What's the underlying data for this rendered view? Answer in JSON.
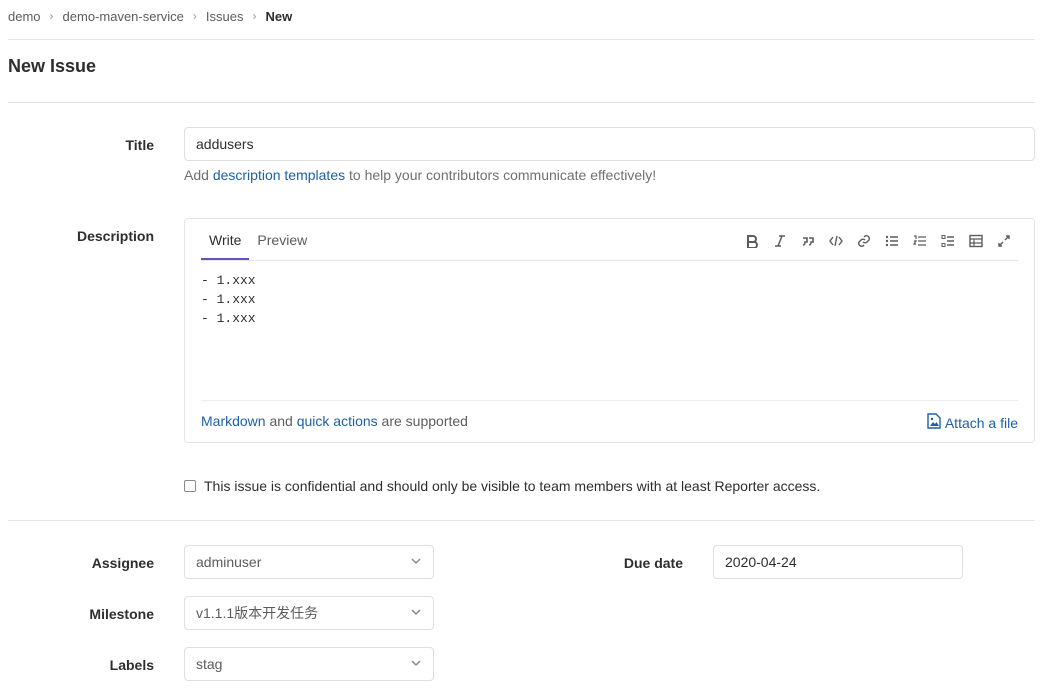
{
  "breadcrumb": [
    "demo",
    "demo-maven-service",
    "Issues",
    "New"
  ],
  "page_title": "New Issue",
  "title_field": {
    "label": "Title",
    "value": "addusers"
  },
  "help": {
    "prefix": "Add ",
    "link": "description templates",
    "suffix": " to help your contributors communicate effectively!"
  },
  "description": {
    "label": "Description",
    "tabs": [
      "Write",
      "Preview"
    ],
    "active_tab": "Write",
    "toolbar_icons": [
      "bold-icon",
      "italic-icon",
      "quote-icon",
      "code-icon",
      "link-icon",
      "bullet-list-icon",
      "numbered-list-icon",
      "task-list-icon",
      "table-icon",
      "fullscreen-icon"
    ],
    "content": "- 1.xxx\n- 1.xxx\n- 1.xxx",
    "footer_link1": "Markdown",
    "footer_and": " and ",
    "footer_link2": "quick actions",
    "footer_suffix": " are supported",
    "attach_label": "Attach a file"
  },
  "confidential_text": "This issue is confidential and should only be visible to team members with at least Reporter access.",
  "assignee": {
    "label": "Assignee",
    "value": "adminuser"
  },
  "milestone": {
    "label": "Milestone",
    "value": "v1.1.1版本开发任务"
  },
  "labels": {
    "label": "Labels",
    "value": "stag"
  },
  "due_date": {
    "label": "Due date",
    "value": "2020-04-24"
  },
  "colors": {
    "link": "#1f5fa6",
    "active_tab_underline": "#6b4fbb",
    "border": "#dfdfdf"
  }
}
